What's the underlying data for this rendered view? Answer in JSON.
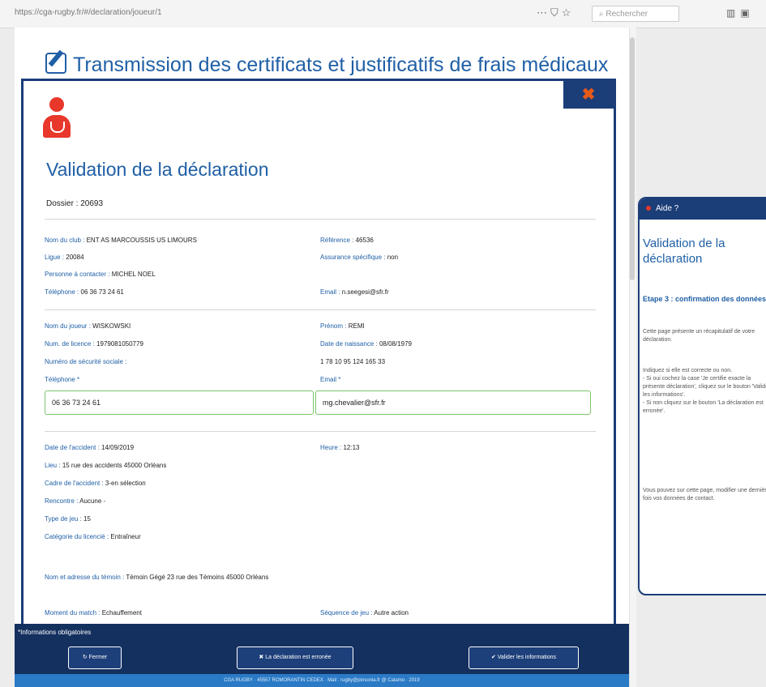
{
  "browser": {
    "url": "https://cga-rugby.fr/#/declaration/joueur/1",
    "search_placeholder": "Rechercher"
  },
  "page": {
    "title": "Transmission des certificats et justificatifs de frais médicaux"
  },
  "modal": {
    "close_label": "✖",
    "title": "Validation de la déclaration",
    "dossier": "Dossier : 20693",
    "club": [
      {
        "label": "Nom du club :",
        "value": "ENT AS MARCOUSSIS US LIMOURS"
      },
      {
        "label": "Référence :",
        "value": "46536"
      },
      {
        "label": "Ligue :",
        "value": "20084"
      },
      {
        "label": "Assurance spécifique :",
        "value": "non"
      },
      {
        "label": "Personne à contacter :",
        "value": "MICHEL NOEL"
      },
      {
        "label": "Téléphone :",
        "value": "06 36 73 24 61"
      },
      {
        "label": "Email :",
        "value": "n.seegesi@sfr.fr"
      }
    ],
    "player": [
      {
        "label": "Nom du joueur :",
        "value": "WISKOWSKI"
      },
      {
        "label": "Prénom :",
        "value": "REMI"
      },
      {
        "label": "Num. de licence :",
        "value": "1979081050779"
      },
      {
        "label": "Date de naissance :",
        "value": "08/08/1979"
      },
      {
        "label": "Numéro de sécurité sociale :",
        "value": ""
      },
      {
        "label": "",
        "value": "1 78 10 95 124 165 33"
      }
    ],
    "phone_label": "Téléphone *",
    "phone_value": "06 36 73 24 61",
    "email_label": "Email *",
    "email_value": "mg.chevalier@sfr.fr",
    "accident": [
      {
        "label": "Date de l'accident :",
        "value": "14/09/2019"
      },
      {
        "label": "Heure :",
        "value": "12:13"
      },
      {
        "label": "Lieu :",
        "value": "15 rue des accidents 45000 Orléans"
      },
      {
        "label": "Cadre de l'accident :",
        "value": "3-en sélection"
      },
      {
        "label": "Rencontre :",
        "value": "Aucune -"
      },
      {
        "label": "Type de jeu :",
        "value": "15"
      },
      {
        "label": "Catégorie du licencié :",
        "value": "Entraîneur"
      }
    ],
    "witness": {
      "label": "Nom et adresse du témoin :",
      "value": "Témoin Gégé 23 rue des Témoins 45000 Orléans"
    },
    "match": [
      {
        "label": "Moment du match :",
        "value": "Echauffement"
      },
      {
        "label": "Séquence de jeu :",
        "value": "Autre action"
      }
    ]
  },
  "footer": {
    "obligatory": "*Informations obligatoires",
    "close_button": "↻ Fermer",
    "error_button": "✖ La déclaration est erronée",
    "validate_button": "✔ Valider les informations",
    "copyright": "CGA RUGBY · 45557 ROMORANTIN CEDEX · Mail : rugby@pinsonia.fr @ Calamo · 2019"
  },
  "help": {
    "header": "Aide ?",
    "title": "Validation de la déclaration",
    "step": "Etape 3 : confirmation des données",
    "p1": "Cette page présente un récapitulatif de votre déclaration.",
    "p2": "Indiquez si elle est correcte ou non.\n- Si oui cochez la case 'Je certifie exacte la présente déclaration', cliquez sur le bouton 'Valider les informations'.\n- Si non cliquez sur le bouton 'La déclaration est erronée'.",
    "p3": "Vous pouvez sur cette page, modifier une dernière fois vos données de contact."
  }
}
